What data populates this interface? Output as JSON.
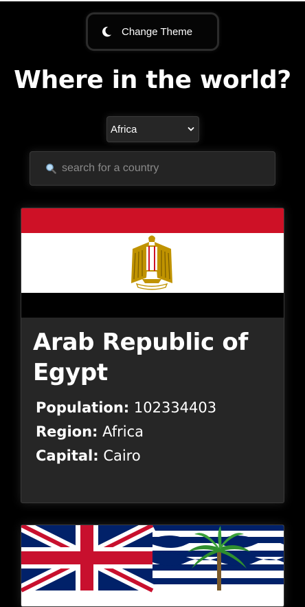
{
  "header": {
    "theme_button_label": "Change Theme",
    "title": "Where in the world?"
  },
  "filter": {
    "region_selected": "Africa"
  },
  "search": {
    "placeholder": "search for a country"
  },
  "countries": [
    {
      "name": "Arab Republic of Egypt",
      "population_label": "Population:",
      "population": "102334403",
      "region_label": "Region:",
      "region": "Africa",
      "capital_label": "Capital:",
      "capital": "Cairo",
      "flag_icon": "egypt-flag"
    },
    {
      "flag_icon": "british-indian-ocean-territory-flag"
    }
  ],
  "colors": {
    "background": "#000000",
    "card": "#262626",
    "text": "#ffffff",
    "egypt_red": "#CE1126",
    "egypt_black": "#000000",
    "egypt_gold": "#C09300",
    "union_blue": "#012169",
    "union_red": "#C8102E"
  }
}
